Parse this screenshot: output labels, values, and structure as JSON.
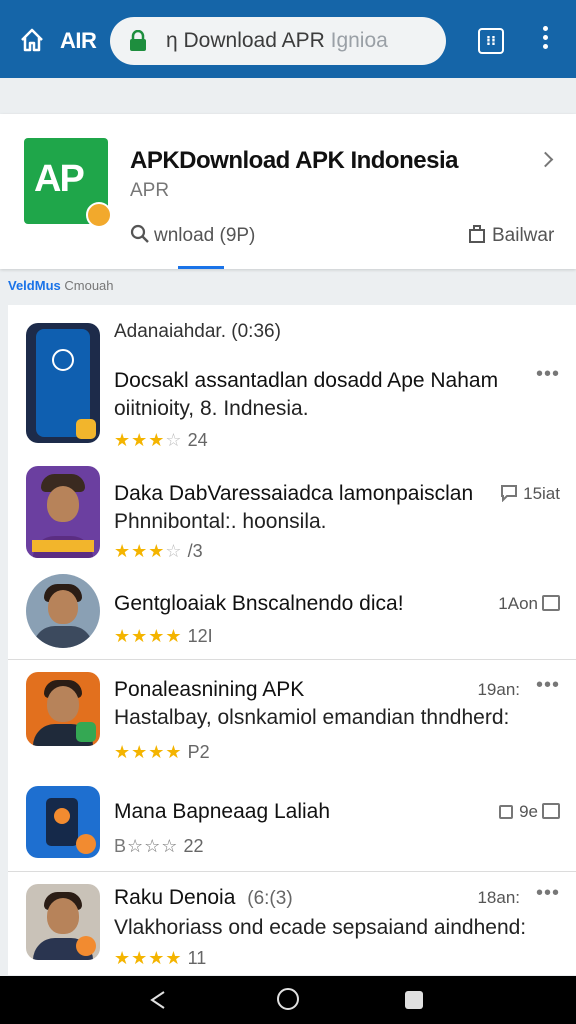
{
  "browser": {
    "brand": "AIR",
    "url_main": "Download APR ",
    "url_faded": "Ignioa",
    "url_prefix": "η ",
    "tabs_count": "⁝⁝"
  },
  "app_header": {
    "title": "APKDownload APK Indonesia",
    "subtitle": "APR",
    "logo_text": "AP",
    "search_label": "wnload (9P)",
    "share_label": "Bailwar",
    "accent_color": "#1a73e8",
    "logo_color": "#1fa64a"
  },
  "section": {
    "label_a": "VeldMus",
    "label_b": "Cmouah"
  },
  "list": {
    "items": [
      {
        "heading": "Adanaiahdar. (0:36)",
        "title": "Docsakl assantadlan dosadd Ape Naham",
        "subtitle": "oiitnioity, 8. Indnesia.",
        "stars": "★★★",
        "stars_off": "☆",
        "count": "24",
        "meta": "",
        "more": "•••"
      },
      {
        "title": "Daka DabVaressaiadca lamonpaisclan",
        "subtitle": "Phnnibontal:. hoonsila.",
        "stars": "★★★",
        "stars_off": "☆",
        "count": "/3",
        "meta": "15iat"
      },
      {
        "title": "Gentgloaiak Bnscalnendo dica!",
        "stars": "★★★★",
        "count": "12I",
        "meta": "1Aon"
      },
      {
        "title": "Ponaleasnining APK",
        "subtitle": "Hastalbay, olsnkamiol emandian thndherd:",
        "stars": "★★★★",
        "count": "P2",
        "meta": "19an:",
        "more": "•••"
      },
      {
        "title": "Mana Bapneaag Laliah",
        "stars": "B☆☆☆",
        "count": "22",
        "meta": "9e"
      },
      {
        "title": "Raku Denoia",
        "title_extra": "(6:(3)",
        "subtitle": "Vlakhoriass ond ecade sepsaiand aindhend:",
        "stars": "★★★★",
        "count": "11",
        "meta": "18an:",
        "more": "•••"
      }
    ]
  }
}
